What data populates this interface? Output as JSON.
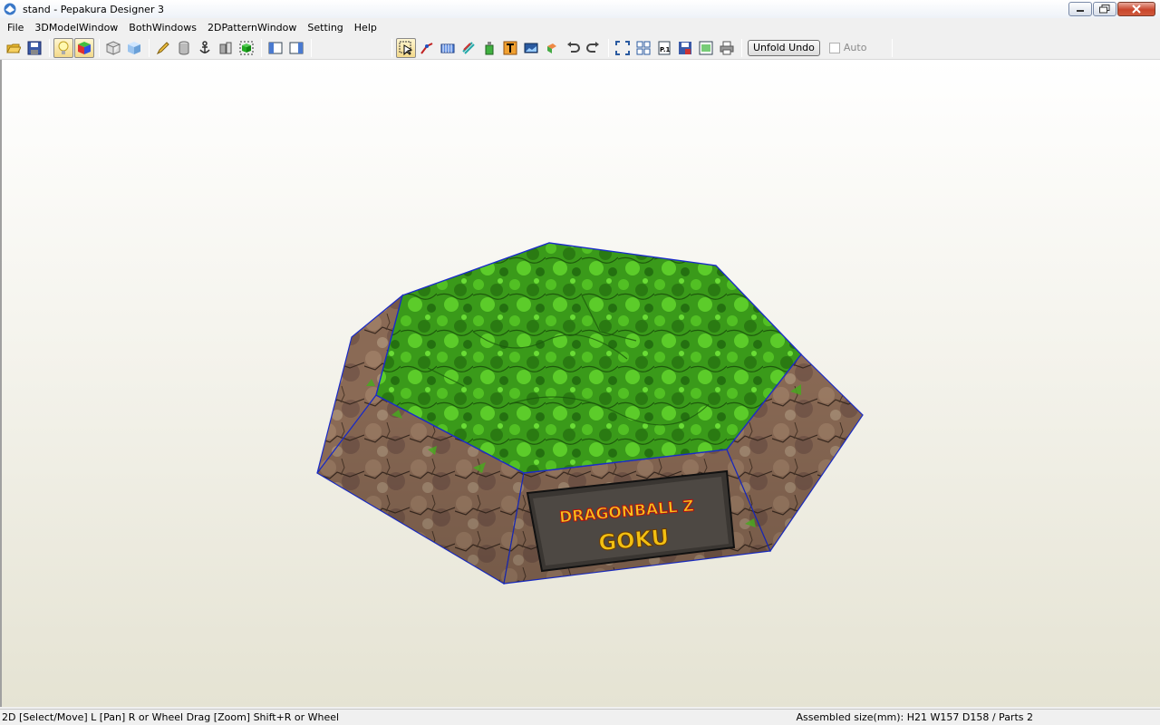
{
  "window": {
    "title": "stand - Pepakura Designer 3"
  },
  "menu": {
    "items": [
      "File",
      "3DModelWindow",
      "BothWindows",
      "2DPatternWindow",
      "Setting",
      "Help"
    ]
  },
  "toolbar": {
    "unfold_undo_label": "Unfold Undo",
    "auto_label": "Auto",
    "auto_checked": false
  },
  "model": {
    "label_line1": "DRAGONBALL Z",
    "label_line2": "GOKU",
    "edge_color": "#1a2cc8",
    "top_color": "#3a9a1a",
    "side_color": "#8a6a55"
  },
  "status": {
    "left": "2D [Select/Move] L [Pan] R or Wheel Drag [Zoom] Shift+R or Wheel",
    "right": "Assembled size(mm): H21 W157 D158 / Parts 2"
  }
}
